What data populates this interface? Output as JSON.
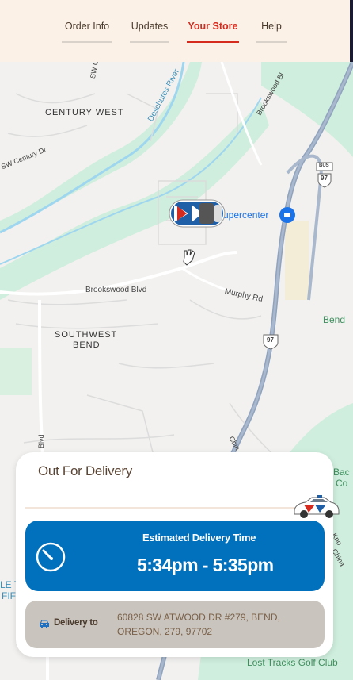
{
  "nav": {
    "tabs": [
      {
        "label": "Order Info",
        "active": false
      },
      {
        "label": "Updates",
        "active": false
      },
      {
        "label": "Your Store",
        "active": true
      },
      {
        "label": "Help",
        "active": false
      }
    ]
  },
  "map": {
    "labels": {
      "century_west": "CENTURY WEST",
      "sw_century_dr": "SW Century Dr",
      "sw_century_top": "SW Cent",
      "deschutes_river": "Deschutes River",
      "brookswood_bl": "Brookswood Bl",
      "bus": "BUS",
      "hwy97_top": "97",
      "hwy97_mid": "97",
      "supercenter": "upercenter",
      "brookswood_blvd": "Brookswood Blvd",
      "murphy_rd": "Murphy Rd",
      "southwest": "SOUTHWEST",
      "bend_district": "BEND",
      "bend": "Bend",
      "blvd_vertical": "Blvd",
      "chin": "Chin",
      "bac": "Bac",
      "co": "Co",
      "kno": "Kno",
      "china": "China",
      "le": "LE T",
      "fif": "FIF",
      "lost_tracks": "Lost Tracks Golf Club"
    }
  },
  "delivery": {
    "status": "Out For Delivery",
    "progress_percent": 100,
    "eta_title": "Estimated Delivery Time",
    "eta_time": "5:34pm - 5:35pm",
    "delivery_to_label": "Delivery to",
    "address": "60828 SW ATWOOD DR #279, BEND, OREGON, 279, 97702"
  },
  "colors": {
    "accent_red": "#d52b1e",
    "eta_blue": "#0271bd",
    "address_bg": "#c9c4bd",
    "nav_bg": "#fbf1e7"
  }
}
